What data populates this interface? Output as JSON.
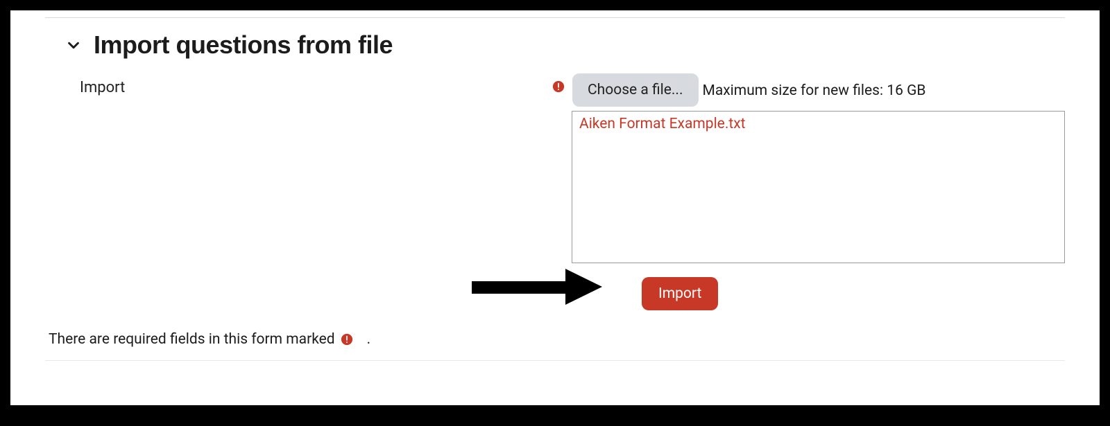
{
  "section": {
    "title": "Import questions from file"
  },
  "form": {
    "import_label": "Import",
    "choose_file_label": "Choose a file...",
    "max_size_text": "Maximum size for new files: 16 GB",
    "selected_file": "Aiken Format Example.txt",
    "submit_label": "Import"
  },
  "footer": {
    "required_note": "There are required fields in this form marked",
    "period": "."
  }
}
